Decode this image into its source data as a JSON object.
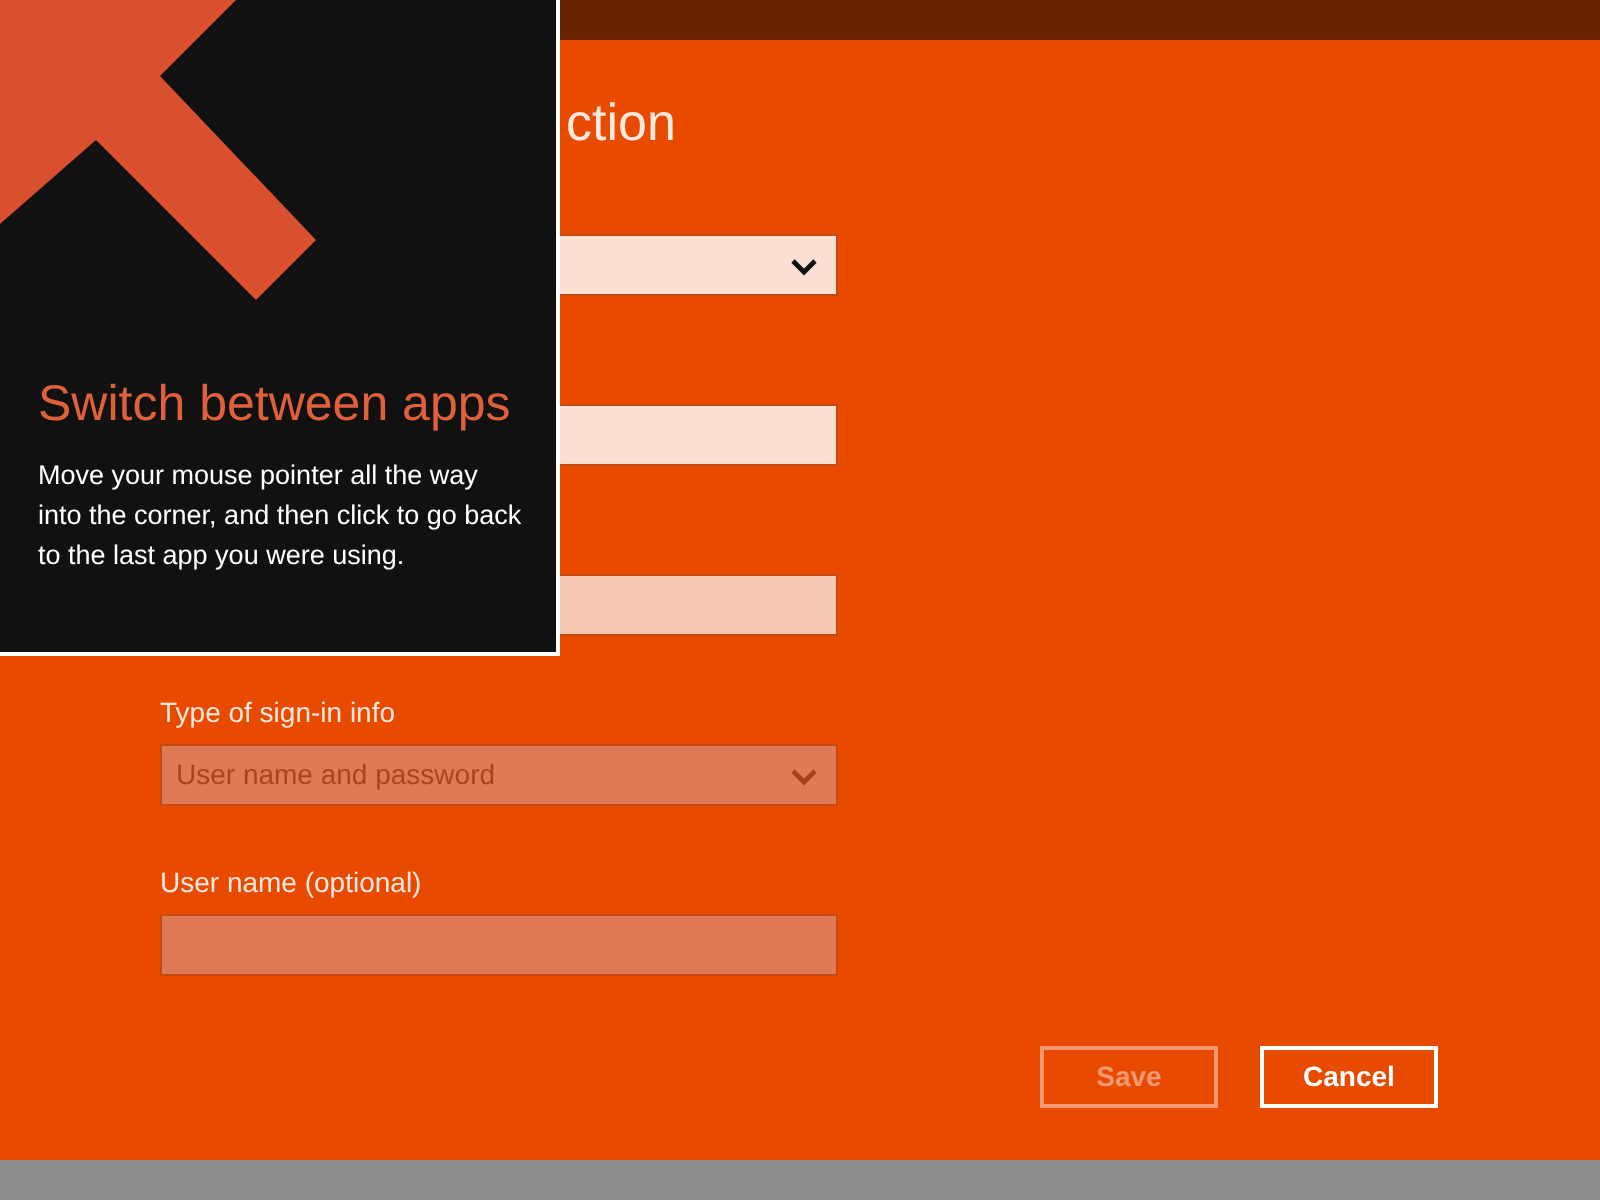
{
  "title": "ction",
  "fields": [
    {
      "kind": "dropdown",
      "disabled": false,
      "hovered": false
    },
    {
      "kind": "text",
      "disabled": false,
      "hovered": false
    },
    {
      "kind": "text",
      "disabled": false,
      "hovered": true
    },
    {
      "kind": "dropdown",
      "label": "Type of sign-in info",
      "value": "User name and password",
      "disabled": true,
      "hovered": false
    },
    {
      "kind": "text",
      "label": "User name (optional)",
      "disabled": true,
      "hovered": false
    }
  ],
  "buttons": [
    {
      "label": "Save",
      "disabled": true
    },
    {
      "label": "Cancel",
      "disabled": false
    }
  ],
  "tip": {
    "title": "Switch between apps",
    "body": "Move your mouse pointer all the way into the corner, and then click to go back to the last app you were using."
  }
}
